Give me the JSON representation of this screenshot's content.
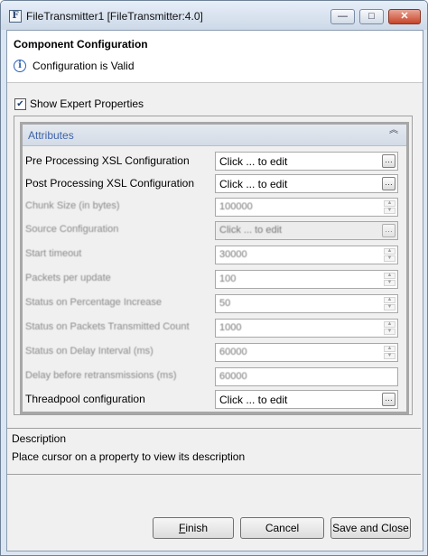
{
  "window": {
    "title": "FileTransmitter1 [FileTransmitter:4.0]",
    "app_icon_letter": "F",
    "controls": {
      "minimize": "—",
      "maximize": "□",
      "close": "✕"
    }
  },
  "header": {
    "title": "Component Configuration",
    "message": "Configuration is Valid",
    "info_glyph": "i"
  },
  "expert": {
    "label": "Show Expert Properties",
    "checked": true,
    "check_glyph": "✔"
  },
  "attributes": {
    "title": "Attributes",
    "collapse_glyph": "︽",
    "rows": [
      {
        "label": "Pre Processing XSL Configuration",
        "value": "Click ... to edit"
      },
      {
        "label": "Post Processing XSL Configuration",
        "value": "Click ... to edit"
      },
      {
        "label": "Chunk Size (in bytes)",
        "value": "100000"
      },
      {
        "label": "Source Configuration",
        "value": "Click ... to edit"
      },
      {
        "label": "Start timeout",
        "value": "30000"
      },
      {
        "label": "Packets per update",
        "value": "100"
      },
      {
        "label": "Status on Percentage Increase",
        "value": "50"
      },
      {
        "label": "Status on Packets Transmitted Count",
        "value": "1000"
      },
      {
        "label": "Status on Delay Interval (ms)",
        "value": "60000"
      },
      {
        "label": "Delay before retransmissions (ms)",
        "value": "60000"
      },
      {
        "label": "Threadpool configuration",
        "value": "Click ... to edit"
      }
    ],
    "edit_glyph": "…",
    "spin_up_glyph": "▲",
    "spin_down_glyph": "▼"
  },
  "description": {
    "title": "Description",
    "text": "Place cursor on a property to view its description"
  },
  "buttons": {
    "finish_first": "F",
    "finish_rest": "inish",
    "cancel": "Cancel",
    "save_close": "Save and Close"
  }
}
